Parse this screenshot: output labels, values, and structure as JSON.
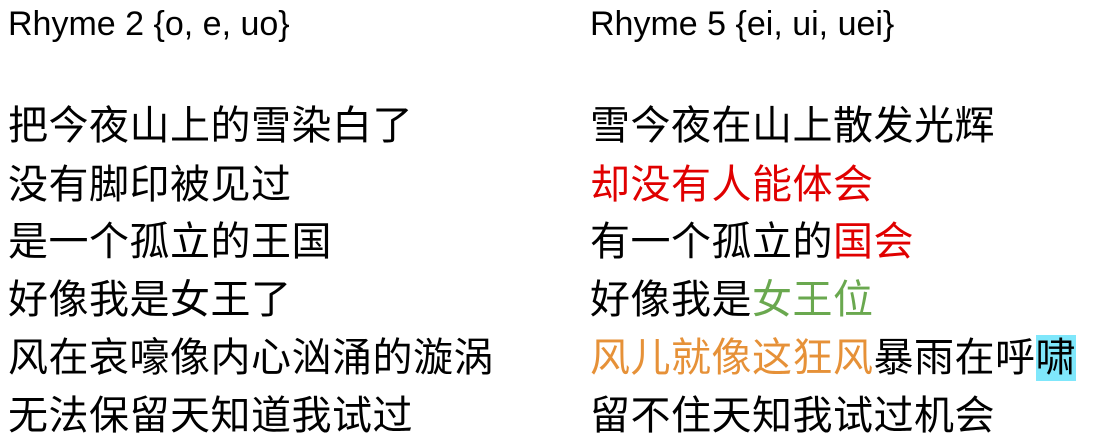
{
  "left": {
    "heading": "Rhyme 2 {o, e, uo}",
    "lines": [
      "把今夜山上的雪染白了",
      "没有脚印被见过",
      "是一个孤立的王国",
      "好像我是女王了",
      "风在哀嚎像内心汹涌的漩涡",
      "无法保留天知道我试过"
    ]
  },
  "right": {
    "heading": "Rhyme 5 {ei, ui, uei}",
    "lines": [
      {
        "segments": [
          {
            "text": "雪今夜在山上散发光辉",
            "color": "#000000"
          }
        ]
      },
      {
        "segments": [
          {
            "text": "却没有人能体会",
            "color": "#e00000"
          }
        ]
      },
      {
        "segments": [
          {
            "text": "有一个孤立的",
            "color": "#000000"
          },
          {
            "text": "国会",
            "color": "#e00000"
          }
        ]
      },
      {
        "segments": [
          {
            "text": "好像我是",
            "color": "#000000"
          },
          {
            "text": "女王位",
            "color": "#6aa84f"
          }
        ]
      },
      {
        "segments": [
          {
            "text": "风儿就像这狂风",
            "color": "#e69138"
          },
          {
            "text": "暴雨在呼",
            "color": "#000000"
          },
          {
            "text": "啸",
            "color": "#000000",
            "highlight": "#7fe7fb"
          }
        ]
      },
      {
        "segments": [
          {
            "text": "留不住天知我试过机会",
            "color": "#000000"
          }
        ]
      }
    ]
  }
}
